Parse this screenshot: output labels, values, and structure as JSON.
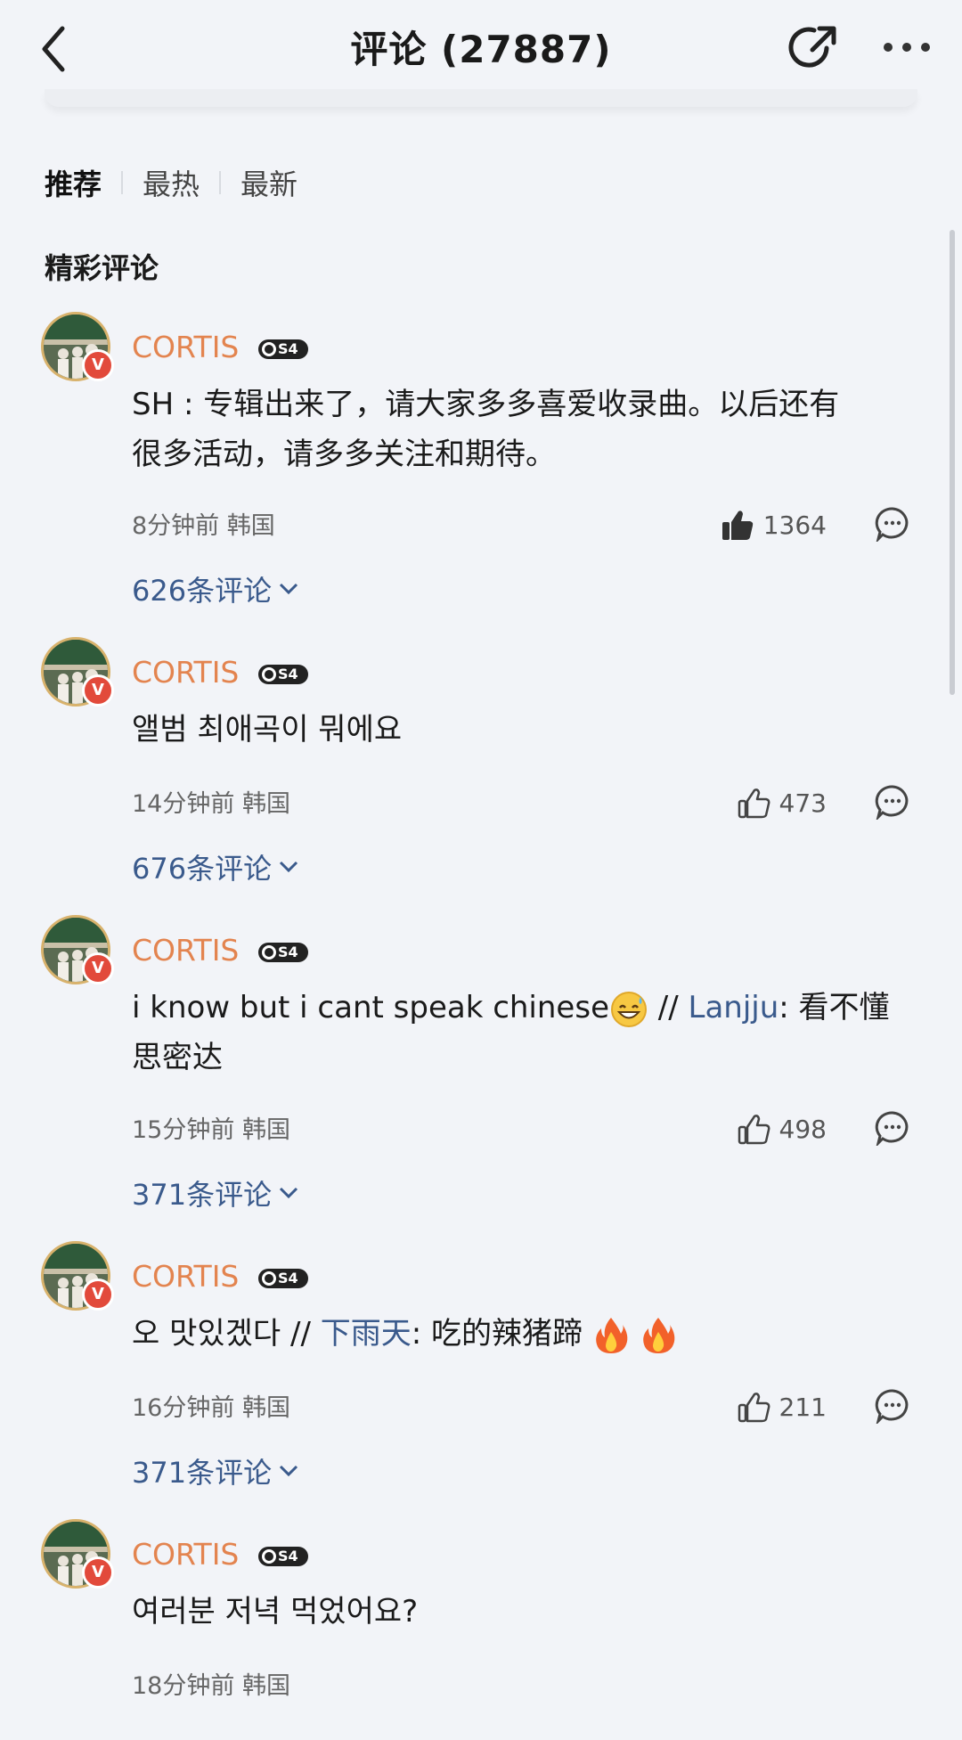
{
  "header": {
    "title": "评论 (27887)"
  },
  "tabs": [
    {
      "label": "推荐",
      "active": true
    },
    {
      "label": "最热",
      "active": false
    },
    {
      "label": "最新",
      "active": false
    }
  ],
  "section_title": "精彩评论",
  "level_badge": "S4",
  "colors": {
    "username": "#e3844f",
    "link": "#3a5a8c",
    "verified": "#e24a3b",
    "background": "#f2f4f8"
  },
  "comments": [
    {
      "user": "CORTIS",
      "text_line1": "SH : 专辑出来了，请大家多多喜爱收录曲。以后还有",
      "text_line2": "很多活动，请多多关注和期待。",
      "time": "8分钟前",
      "location": "韩国",
      "likes": "1364",
      "liked": true,
      "replies": "626条评论"
    },
    {
      "user": "CORTIS",
      "text_line1": "앨범 최애곡이 뭐에요",
      "time": "14分钟前",
      "location": "韩国",
      "likes": "473",
      "liked": false,
      "replies": "676条评论"
    },
    {
      "user": "CORTIS",
      "text_main": "i know but i cant speak chinese",
      "emoji": "grinning-sweat-emoji",
      "separator": " // ",
      "mention": "Lanjju",
      "quoted_1": ": 看不懂",
      "text_line2": "思密达",
      "time": "15分钟前",
      "location": "韩国",
      "likes": "498",
      "liked": false,
      "replies": "371条评论"
    },
    {
      "user": "CORTIS",
      "text_main": "오 맛있겠다",
      "separator": " // ",
      "mention": "下雨天",
      "quoted_1": ": 吃的辣猪蹄",
      "emoji": "fire-emoji",
      "time": "16分钟前",
      "location": "韩国",
      "likes": "211",
      "liked": false,
      "replies": "371条评论"
    },
    {
      "user": "CORTIS",
      "text_line1": "여러분 저녁 먹었어요?",
      "time": "18分钟前",
      "location": "韩国"
    }
  ]
}
